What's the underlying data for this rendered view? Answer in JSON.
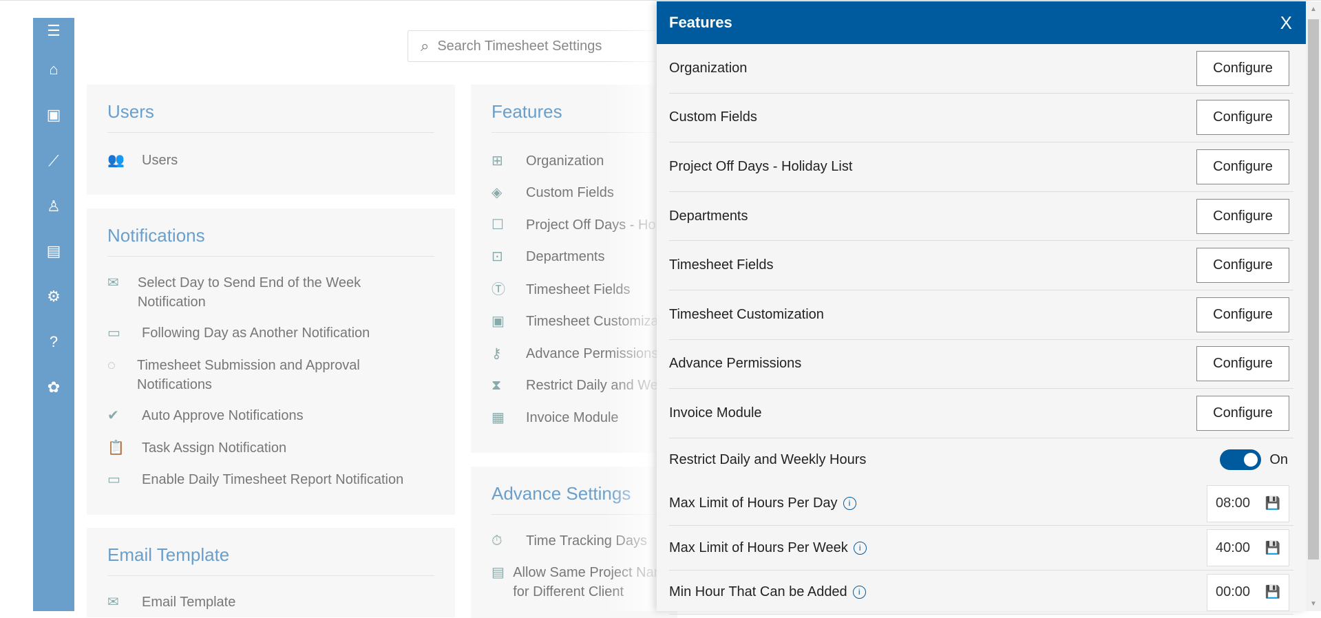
{
  "search": {
    "placeholder": "Search Timesheet Settings"
  },
  "sidebar": {
    "icons": [
      "menu-icon",
      "home-icon",
      "timesheet-icon",
      "chart-icon",
      "user-settings-icon",
      "report-icon",
      "gear-icon",
      "help-icon",
      "billing-icon"
    ]
  },
  "users": {
    "title": "Users",
    "items": [
      "Users"
    ]
  },
  "notifications": {
    "title": "Notifications",
    "items": [
      "Select Day to Send End of the Week Notification",
      "Following Day as Another Notification",
      "Timesheet Submission and Approval Notifications",
      "Auto Approve Notifications",
      "Task Assign Notification",
      "Enable Daily Timesheet Report Notification"
    ]
  },
  "email": {
    "title": "Email Template",
    "items": [
      "Email Template"
    ]
  },
  "features": {
    "title": "Features",
    "items": [
      "Organization",
      "Custom Fields",
      "Project Off Days - Holiday List",
      "Departments",
      "Timesheet Fields",
      "Timesheet Customization",
      "Advance Permissions",
      "Restrict Daily and Weekly Hours",
      "Invoice Module"
    ]
  },
  "advance": {
    "title": "Advance Settings",
    "items": [
      "Time Tracking Days",
      "Allow Same Project Name for Different Client"
    ]
  },
  "panel": {
    "title": "Features",
    "close": "X",
    "configure": "Configure",
    "rows": [
      "Organization",
      "Custom Fields",
      "Project Off Days - Holiday List",
      "Departments",
      "Timesheet Fields",
      "Timesheet Customization",
      "Advance Permissions",
      "Invoice Module"
    ],
    "toggle": {
      "label": "Restrict Daily and Weekly Hours",
      "state": "On"
    },
    "inputs": [
      {
        "label": "Max Limit of Hours Per Day",
        "value": "08:00"
      },
      {
        "label": "Max Limit of Hours Per Week",
        "value": "40:00"
      },
      {
        "label": "Min Hour That Can be Added",
        "value": "00:00"
      }
    ],
    "info": "i"
  }
}
